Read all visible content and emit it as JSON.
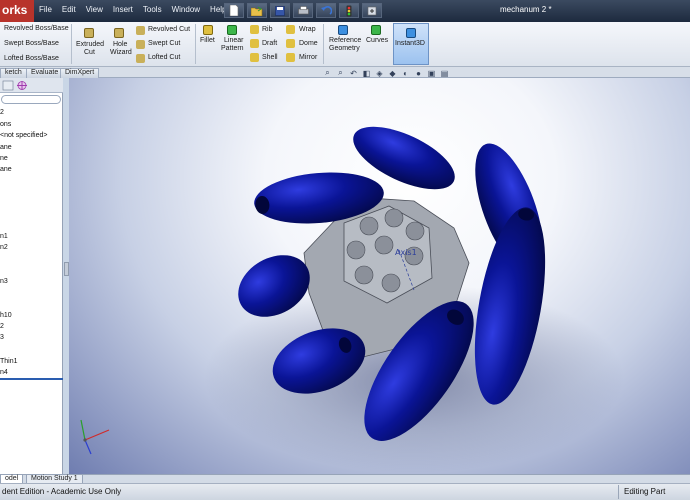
{
  "app": {
    "logo_text": "orks",
    "document_title": "mechanum 2 *"
  },
  "menu": [
    "File",
    "Edit",
    "View",
    "Insert",
    "Tools",
    "Window",
    "Help"
  ],
  "quick_access_icons": [
    "new-icon",
    "open-icon",
    "save-icon",
    "print-icon",
    "undo-icon",
    "rebuild-icon",
    "options-icon"
  ],
  "ribbon": {
    "boss_group": [
      "Revolved Boss/Base",
      "Swept Boss/Base",
      "Lofted Boss/Base"
    ],
    "extruded_cut": [
      "Extruded",
      "Cut"
    ],
    "hole_wizard": [
      "Hole",
      "Wizard"
    ],
    "cut_group": [
      "Revolved Cut",
      "Swept Cut",
      "Lofted Cut"
    ],
    "fillet": "Fillet",
    "linear_pattern": [
      "Linear",
      "Pattern"
    ],
    "features_col1": [
      "Rib",
      "Draft",
      "Shell"
    ],
    "features_col2": [
      "Wrap",
      "Dome",
      "Mirror"
    ],
    "reference_geometry": [
      "Reference",
      "Geometry"
    ],
    "curves": "Curves",
    "instant3d": "Instant3D"
  },
  "command_tabs": [
    "ketch",
    "Evaluate",
    "DimXpert"
  ],
  "feature_tree": [
    "2",
    "ons",
    " <not specified>",
    "ane",
    "ne",
    "ane",
    "",
    "",
    "",
    "n1",
    "n2",
    "",
    "n3",
    "",
    "h10",
    "2",
    "3",
    "Thin1",
    "n4"
  ],
  "model": {
    "axis_label": "Axis1",
    "roller_color": "#0a1496",
    "hub_color": "#9fa4ad"
  },
  "bottom_tabs": [
    "odel",
    "Motion Study 1"
  ],
  "status": {
    "left": "dent Edition - Academic Use Only",
    "right": "Editing Part"
  }
}
